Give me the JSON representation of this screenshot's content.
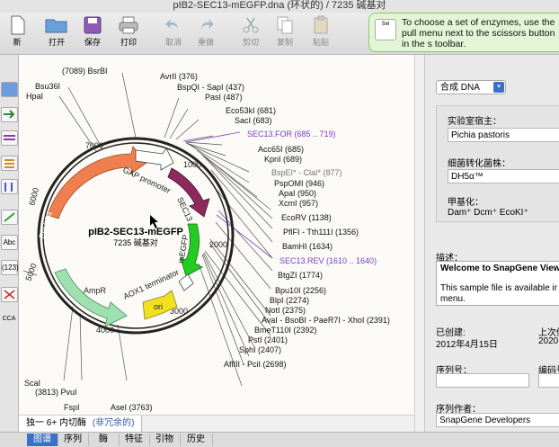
{
  "window": {
    "title": "pIB2-SEC13-mEGFP.dna  (环状的) / 7235 碱基对"
  },
  "toolbar": {
    "new": "新",
    "open": "打开",
    "save": "保存",
    "print": "打印",
    "undo": "取消",
    "redo": "重做",
    "cut": "剪切",
    "copy": "复制",
    "paste": "粘贴"
  },
  "tooltip": {
    "icon_text": "Sel",
    "text": "To choose a set of enzymes, use the pull menu next to the scissors button in the s toolbar."
  },
  "left_tools": {
    "select_label": "Abc",
    "count_label": "(123)",
    "cca_label": "CCA"
  },
  "map": {
    "name": "pIB2-SEC13-mEGFP",
    "size": "7235 碱基对",
    "ticks": [
      "1000",
      "2000",
      "3000",
      "4000",
      "5000",
      "6000",
      "7000"
    ],
    "features": {
      "gap": "GAP promoter",
      "sec13": "SEC13",
      "megfp": "mEGFP",
      "aox1": "AOX1 terminator",
      "ori": "ori",
      "ampr": "AmpR",
      "his4": "PpHIS4"
    },
    "sites_right": [
      "AvrII  (376)",
      "BspQI - SapI  (437)",
      "PasI  (487)",
      "Eco53kI  (681)",
      "SacI  (683)",
      "SEC13.FOR   (685 .. 719)",
      "Acc65I  (685)",
      "KpnI  (689)",
      "BspEI* - ClaI*  (877)",
      "PspOMI  (946)",
      "ApaI  (950)",
      "XcmI  (957)",
      "EcoRV  (1138)",
      "PflFI - Tth111I  (1356)",
      "BamHI  (1634)",
      "SEC13.REV   (1610 .. 1640)",
      "BtgZI  (1774)",
      "Bpu10I  (2256)",
      "BlpI  (2274)",
      "NotI  (2375)",
      "AvaI - BsoBI - PaeR7I - XhoI  (2391)",
      "BmeT110I  (2392)",
      "PstI  (2401)",
      "SphI  (2407)",
      "AflIII - PciI  (2698)"
    ],
    "sites_left": [
      "(7089)  BsrBI",
      "Bsu36I",
      "HpaI",
      "ScaI",
      "(3813)  PvuI",
      "FspI",
      "AseI  (3763)",
      "sI",
      "I",
      "oI"
    ]
  },
  "status": {
    "enzymes": "独一 6+ 内切酶",
    "nonredundant": "(非冗余的)"
  },
  "panel": {
    "dropdown": "合成 DNA",
    "host_label": "实验室宿主：",
    "host_value": "Pichia pastoris",
    "strain_label": "细菌转化菌株：",
    "strain_value": "DH5α™",
    "methyl_label": "甲基化：",
    "methyl_value": "Dam⁺  Dcm⁺  EcoKI⁺",
    "desc_label": "描述：",
    "desc_line1": "Welcome to SnapGene View",
    "desc_line2": "This sample file is available ir",
    "desc_line3": "menu.",
    "created_label": "已创建:",
    "created_value": "2012年4月15日",
    "modified_label": "上次修",
    "modified_value": "2020",
    "serial_label": "序列号：",
    "code_label": "编码号",
    "author_label": "序列作者：",
    "author_value": "SnapGene Developers"
  },
  "tabs": [
    "图谱",
    "序列",
    "酶",
    "特征",
    "引物",
    "历史"
  ],
  "colors": {
    "accent": "#3c6fc8",
    "primer": "#7b3fc4",
    "his4": "#f07f4f",
    "ampr": "#9fe0b0",
    "ori": "#f0e020",
    "megfp": "#22cc22",
    "sec13": "#8c2a5c"
  }
}
